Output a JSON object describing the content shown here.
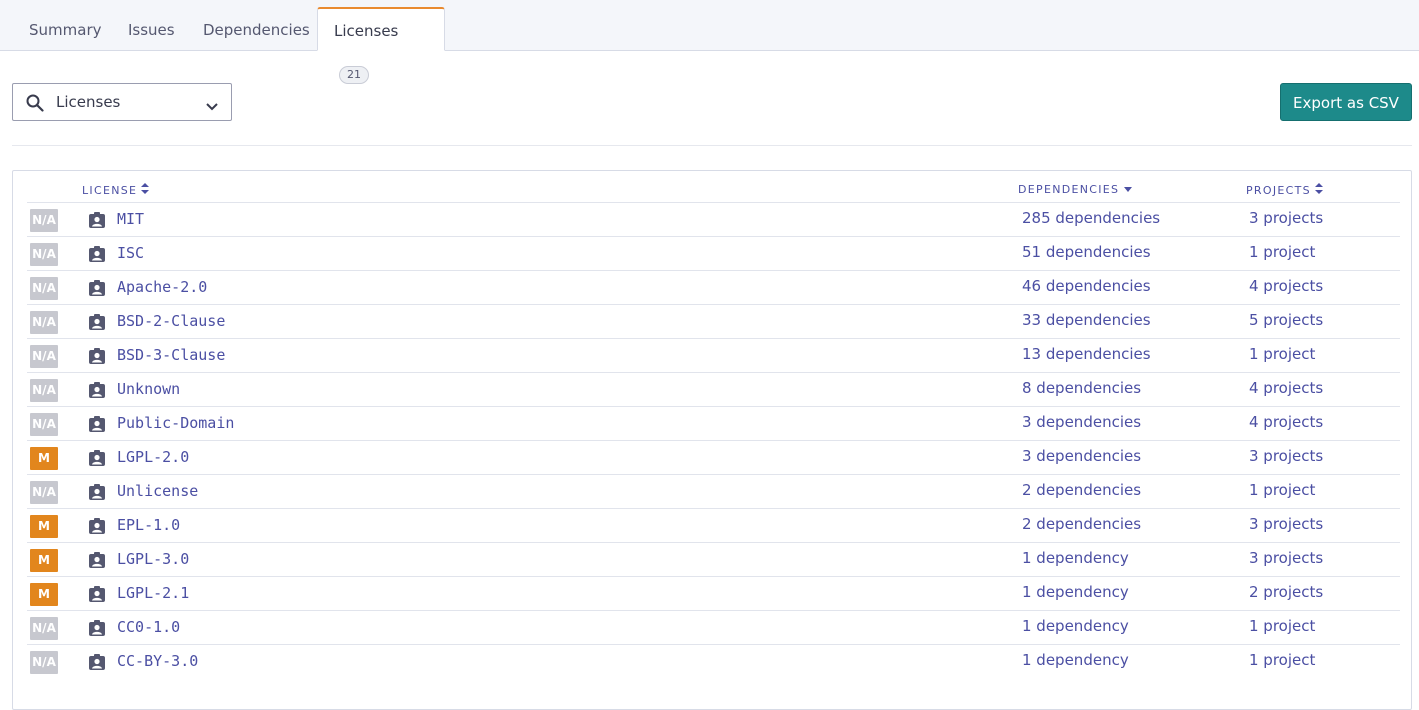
{
  "tabs": [
    {
      "label": "Summary"
    },
    {
      "label": "Issues"
    },
    {
      "label": "Dependencies"
    },
    {
      "label": "Licenses",
      "count": "21",
      "active": true
    }
  ],
  "filter": {
    "label": "Licenses",
    "icon": "search-icon",
    "dropdown_icon": "chevron-down-icon"
  },
  "export_button": {
    "label": "Export as CSV",
    "color": "#1d8a8a"
  },
  "table": {
    "headers": {
      "license": "LICENSE",
      "dependencies": "DEPENDENCIES",
      "projects": "PROJECTS"
    },
    "rows": [
      {
        "badge": "N/A",
        "severity": "na",
        "license": "MIT",
        "dependencies": "285 dependencies",
        "projects": "3 projects"
      },
      {
        "badge": "N/A",
        "severity": "na",
        "license": "ISC",
        "dependencies": "51 dependencies",
        "projects": "1 project"
      },
      {
        "badge": "N/A",
        "severity": "na",
        "license": "Apache-2.0",
        "dependencies": "46 dependencies",
        "projects": "4 projects"
      },
      {
        "badge": "N/A",
        "severity": "na",
        "license": "BSD-2-Clause",
        "dependencies": "33 dependencies",
        "projects": "5 projects"
      },
      {
        "badge": "N/A",
        "severity": "na",
        "license": "BSD-3-Clause",
        "dependencies": "13 dependencies",
        "projects": "1 project"
      },
      {
        "badge": "N/A",
        "severity": "na",
        "license": "Unknown",
        "dependencies": "8 dependencies",
        "projects": "4 projects"
      },
      {
        "badge": "N/A",
        "severity": "na",
        "license": "Public-Domain",
        "dependencies": "3 dependencies",
        "projects": "4 projects"
      },
      {
        "badge": "M",
        "severity": "m",
        "license": "LGPL-2.0",
        "dependencies": "3 dependencies",
        "projects": "3 projects"
      },
      {
        "badge": "N/A",
        "severity": "na",
        "license": "Unlicense",
        "dependencies": "2 dependencies",
        "projects": "1 project"
      },
      {
        "badge": "M",
        "severity": "m",
        "license": "EPL-1.0",
        "dependencies": "2 dependencies",
        "projects": "3 projects"
      },
      {
        "badge": "M",
        "severity": "m",
        "license": "LGPL-3.0",
        "dependencies": "1 dependency",
        "projects": "3 projects"
      },
      {
        "badge": "M",
        "severity": "m",
        "license": "LGPL-2.1",
        "dependencies": "1 dependency",
        "projects": "2 projects"
      },
      {
        "badge": "N/A",
        "severity": "na",
        "license": "CC0-1.0",
        "dependencies": "1 dependency",
        "projects": "1 project"
      },
      {
        "badge": "N/A",
        "severity": "na",
        "license": "CC-BY-3.0",
        "dependencies": "1 dependency",
        "projects": "1 project"
      }
    ]
  },
  "colors": {
    "active_tab_accent": "#e98a2f",
    "link": "#4b4fa3",
    "badge_medium": "#e2861d",
    "badge_na": "#c7c8cf"
  }
}
